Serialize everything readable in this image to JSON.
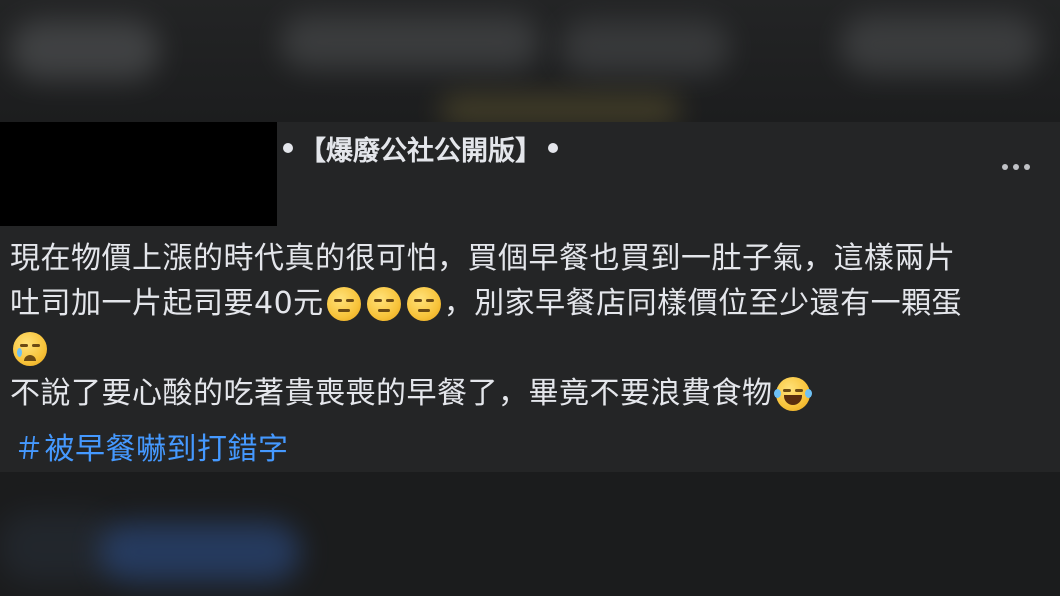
{
  "post": {
    "group_name": "【爆廢公社公開版】",
    "body": {
      "line1": "現在物價上漲的時代真的很可怕，買個早餐也買到一肚子氣，這樣兩片",
      "line2_text": "吐司加一片起司要40元",
      "line2_text_after": "，別家早餐店同樣價位至少還有一顆蛋",
      "line4_text": "不說了要心酸的吃著貴喪喪的早餐了，畢竟不要浪費食物"
    },
    "hashtag": "＃被早餐嚇到打錯字",
    "icons": {
      "more": "more-horizontal-icon",
      "emoji_pensive": "pensive-face-emoji",
      "emoji_crying": "crying-face-emoji",
      "emoji_laughing": "tears-of-joy-emoji"
    }
  },
  "colors": {
    "background": "#18191a",
    "post_background": "#242526",
    "text": "#e4e6eb",
    "hashtag": "#4599ff"
  }
}
